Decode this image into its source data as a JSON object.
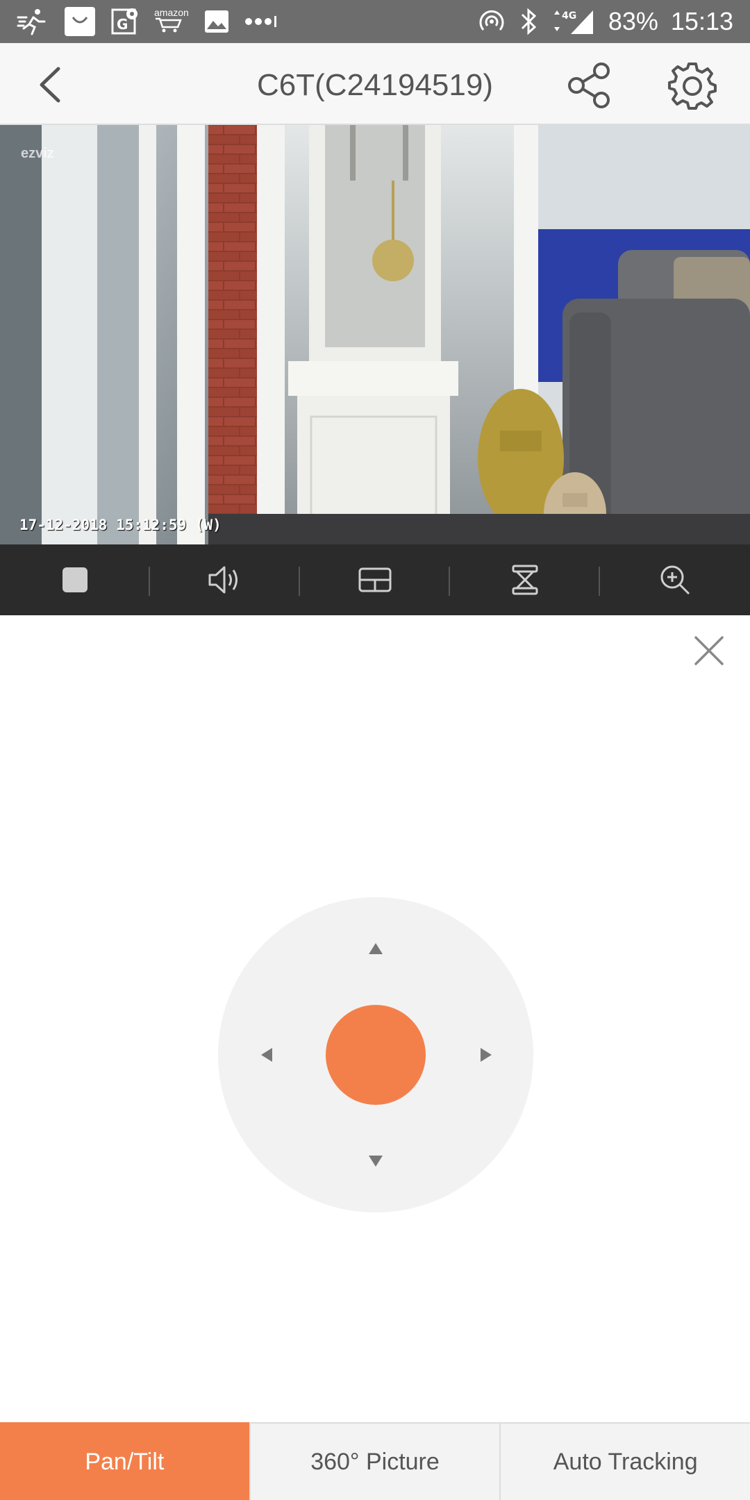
{
  "status_bar": {
    "battery": "83%",
    "time": "15:13",
    "network": "4G",
    "notification_icons": [
      "activity-icon",
      "shopping-bag-icon",
      "maps-icon",
      "amazon-icon",
      "gallery-icon",
      "more-dots-icon"
    ],
    "amazon_label": "amazon"
  },
  "header": {
    "title": "C6T(C24194519)"
  },
  "video": {
    "timestamp": "17-12-2018 15:12:59  (W)",
    "watermark": "ezviz"
  },
  "toolbar": {
    "items": [
      "stop-icon",
      "volume-icon",
      "quality-icon",
      "ptz-icon",
      "zoom-in-icon"
    ]
  },
  "tabs": {
    "items": [
      {
        "label": "Pan/Tilt",
        "active": true
      },
      {
        "label": "360° Picture",
        "active": false
      },
      {
        "label": "Auto Tracking",
        "active": false
      }
    ]
  },
  "colors": {
    "accent": "#f3804b",
    "status_bar": "#6d6d6d",
    "toolbar": "#2b2b2b"
  }
}
